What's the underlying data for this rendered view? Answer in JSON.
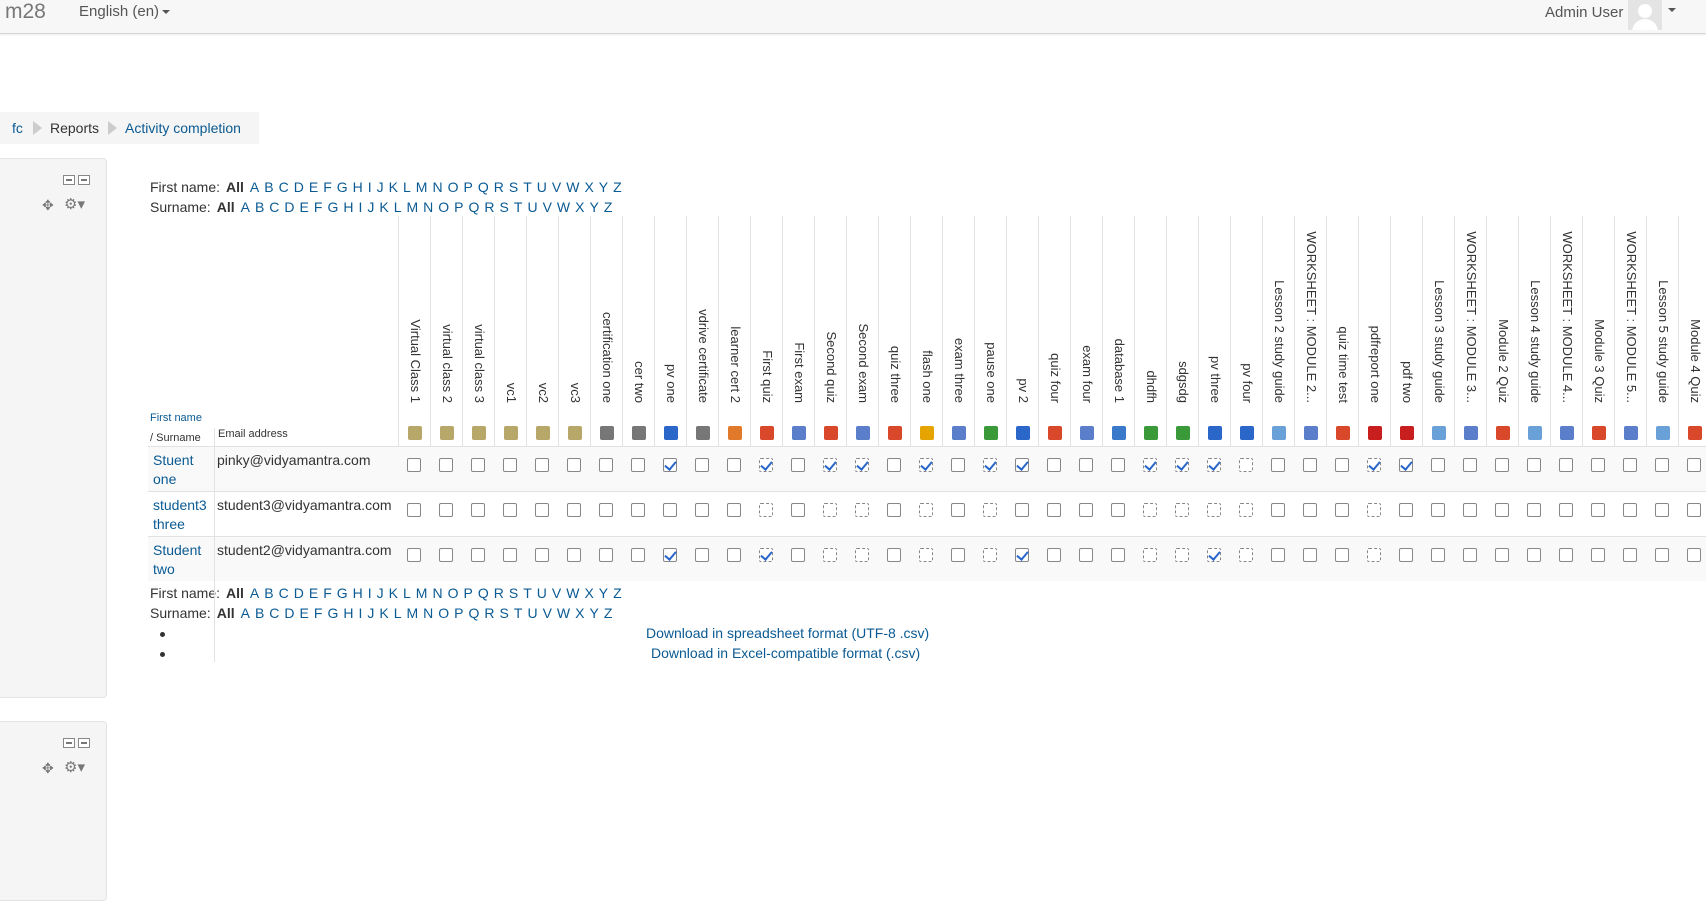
{
  "navbar": {
    "brand": "m28",
    "language": "English (en)",
    "user": "Admin User"
  },
  "breadcrumb": [
    "fc",
    "Reports",
    "Activity completion"
  ],
  "filters": {
    "first_label": "First name:",
    "surname_label": "Surname:",
    "all": "All",
    "letters": [
      "A",
      "B",
      "C",
      "D",
      "E",
      "F",
      "G",
      "H",
      "I",
      "J",
      "K",
      "L",
      "M",
      "N",
      "O",
      "P",
      "Q",
      "R",
      "S",
      "T",
      "U",
      "V",
      "W",
      "X",
      "Y",
      "Z"
    ]
  },
  "table": {
    "col_firstname": "First name",
    "col_surname": "/ Surname",
    "col_email": "Email address",
    "activities": [
      {
        "label": "Virtual Class 1",
        "icon": "virtual-class-icon",
        "color": "#b7a86a"
      },
      {
        "label": "virtual class 2",
        "icon": "virtual-class-icon",
        "color": "#b7a86a"
      },
      {
        "label": "virtual class 3",
        "icon": "virtual-class-icon",
        "color": "#b7a86a"
      },
      {
        "label": "vc1",
        "icon": "virtual-class-icon",
        "color": "#b7a86a"
      },
      {
        "label": "vc2",
        "icon": "virtual-class-icon",
        "color": "#b7a86a"
      },
      {
        "label": "vc3",
        "icon": "virtual-class-icon",
        "color": "#b7a86a"
      },
      {
        "label": "certification one",
        "icon": "certificate-icon",
        "color": "#777777"
      },
      {
        "label": "cer two",
        "icon": "certificate-icon",
        "color": "#777777"
      },
      {
        "label": "pv one",
        "icon": "video-icon",
        "color": "#2b66c9"
      },
      {
        "label": "vdrive certificate",
        "icon": "certificate-icon",
        "color": "#777777"
      },
      {
        "label": "learner cert 2",
        "icon": "learner-cert-icon",
        "color": "#e07a2a"
      },
      {
        "label": "First quiz",
        "icon": "quiz-icon",
        "color": "#d9482b"
      },
      {
        "label": "First exam",
        "icon": "exam-icon",
        "color": "#5a7ec9"
      },
      {
        "label": "Second quiz",
        "icon": "quiz-icon",
        "color": "#d9482b"
      },
      {
        "label": "Second exam",
        "icon": "exam-icon",
        "color": "#5a7ec9"
      },
      {
        "label": "quiz three",
        "icon": "quiz-icon",
        "color": "#d9482b"
      },
      {
        "label": "flash one",
        "icon": "flash-icon",
        "color": "#e5a400"
      },
      {
        "label": "exam three",
        "icon": "exam-icon",
        "color": "#5a7ec9"
      },
      {
        "label": "pause one",
        "icon": "pause-icon",
        "color": "#3a9a3a"
      },
      {
        "label": "pv 2",
        "icon": "video-icon",
        "color": "#2b66c9"
      },
      {
        "label": "quiz four",
        "icon": "quiz-icon",
        "color": "#d9482b"
      },
      {
        "label": "exam four",
        "icon": "exam-icon",
        "color": "#5a7ec9"
      },
      {
        "label": "database 1",
        "icon": "database-icon",
        "color": "#3a78c9"
      },
      {
        "label": "dhdfh",
        "icon": "pause-icon",
        "color": "#3a9a3a"
      },
      {
        "label": "sdgsdg",
        "icon": "pause-icon",
        "color": "#3a9a3a"
      },
      {
        "label": "pv three",
        "icon": "video-icon",
        "color": "#2b66c9"
      },
      {
        "label": "pv four",
        "icon": "video-icon",
        "color": "#2b66c9"
      },
      {
        "label": "Lesson 2 study guide",
        "icon": "page-icon",
        "color": "#6aa0d8"
      },
      {
        "label": "WORKSHEET : MODULE 2...",
        "icon": "worksheet-icon",
        "color": "#5a7ec9"
      },
      {
        "label": "quiz time test",
        "icon": "quiz-icon",
        "color": "#d9482b"
      },
      {
        "label": "pdfreport one",
        "icon": "pdf-icon",
        "color": "#c81e1e"
      },
      {
        "label": "pdf two",
        "icon": "pdf-icon",
        "color": "#c81e1e"
      },
      {
        "label": "Lesson 3 study guide",
        "icon": "page-icon",
        "color": "#6aa0d8"
      },
      {
        "label": "WORKSHEET : MODULE 3...",
        "icon": "worksheet-icon",
        "color": "#5a7ec9"
      },
      {
        "label": "Module 2 Quiz",
        "icon": "quiz-icon",
        "color": "#d9482b"
      },
      {
        "label": "Lesson 4 study guide",
        "icon": "page-icon",
        "color": "#6aa0d8"
      },
      {
        "label": "WORKSHEET : MODULE 4...",
        "icon": "worksheet-icon",
        "color": "#5a7ec9"
      },
      {
        "label": "Module 3 Quiz",
        "icon": "quiz-icon",
        "color": "#d9482b"
      },
      {
        "label": "WORKSHEET : MODULE 5...",
        "icon": "worksheet-icon",
        "color": "#5a7ec9"
      },
      {
        "label": "Lesson 5 study guide",
        "icon": "page-icon",
        "color": "#6aa0d8"
      },
      {
        "label": "Module 4 Quiz",
        "icon": "quiz-icon",
        "color": "#d9482b"
      }
    ],
    "rows": [
      {
        "first": "Stuent",
        "last": "one",
        "email": "pinky@vidyamantra.com",
        "status": "nnnnnnnncnnCnCCnCnCcnnnCCCDnnnCcnnnnnnnnn"
      },
      {
        "first": "student3",
        "last": "three",
        "email": "student3@vidyamantra.com",
        "status": "nnnnnnnnnnnDnDDnDnDnnnnDDDDnnnDnnnnnnnnnn"
      },
      {
        "first": "Student",
        "last": "two",
        "email": "student2@vidyamantra.com",
        "status": "nnnnnnnncnnCnDDnDnDcnnnDDCDnnnDnnnnnnnnnn"
      }
    ]
  },
  "downloads": [
    "Download in spreadsheet format (UTF-8 .csv)",
    "Download in Excel-compatible format (.csv)"
  ]
}
